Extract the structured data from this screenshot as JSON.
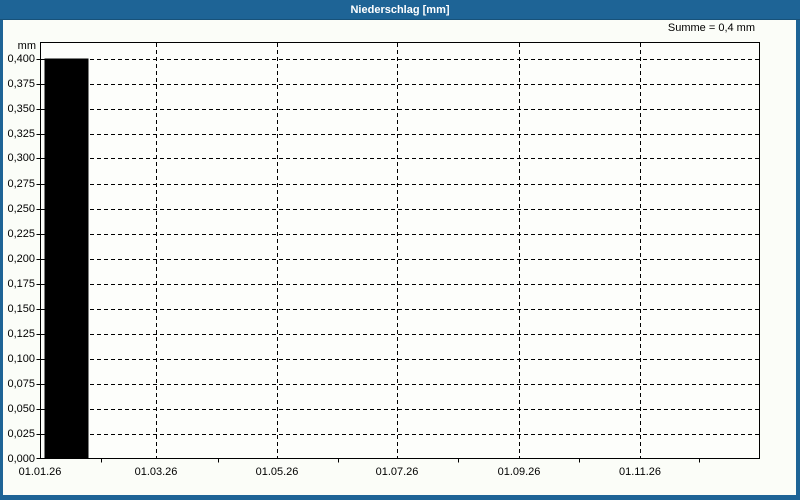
{
  "window": {
    "title": "Niederschlag [mm]"
  },
  "colors": {
    "titlebar": "#1e6496",
    "window_border": "#1e6496",
    "content_background": "#fbfdf8",
    "plot_background": "#fdfefb",
    "grid": "#000000",
    "bar": "#000000",
    "title_text": "#ffffff",
    "axis_text": "#000000"
  },
  "chart_data": {
    "type": "bar",
    "title": "Niederschlag [mm]",
    "annotation": "Summe = 0,4 mm",
    "ylabel": "mm",
    "ylim": [
      0,
      0.4
    ],
    "y_tick_step": 0.025,
    "y_tick_labels": [
      "0,400",
      "0,375",
      "0,350",
      "0,325",
      "0,300",
      "0,275",
      "0,250",
      "0,225",
      "0,200",
      "0,175",
      "0,150",
      "0,125",
      "0,100",
      "0,075",
      "0,050",
      "0,025",
      "0,000"
    ],
    "x_axis": {
      "range_days": 365,
      "major_tick_labels": [
        "01.01.26",
        "01.03.26",
        "01.05.26",
        "01.07.26",
        "01.09.26",
        "01.11.26"
      ],
      "major_tick_days": [
        0,
        59,
        120,
        181,
        243,
        304
      ],
      "gridline_days": [
        59,
        120,
        181,
        243,
        304
      ],
      "minor_tick_days": [
        31,
        90,
        151,
        212,
        273,
        334
      ]
    },
    "grid": "dashed",
    "legend": "none",
    "series": [
      {
        "name": "Niederschlag",
        "bars": [
          {
            "x": "01.01.26",
            "value": 0.4,
            "value_formatted": "0,4 mm"
          }
        ]
      }
    ]
  }
}
